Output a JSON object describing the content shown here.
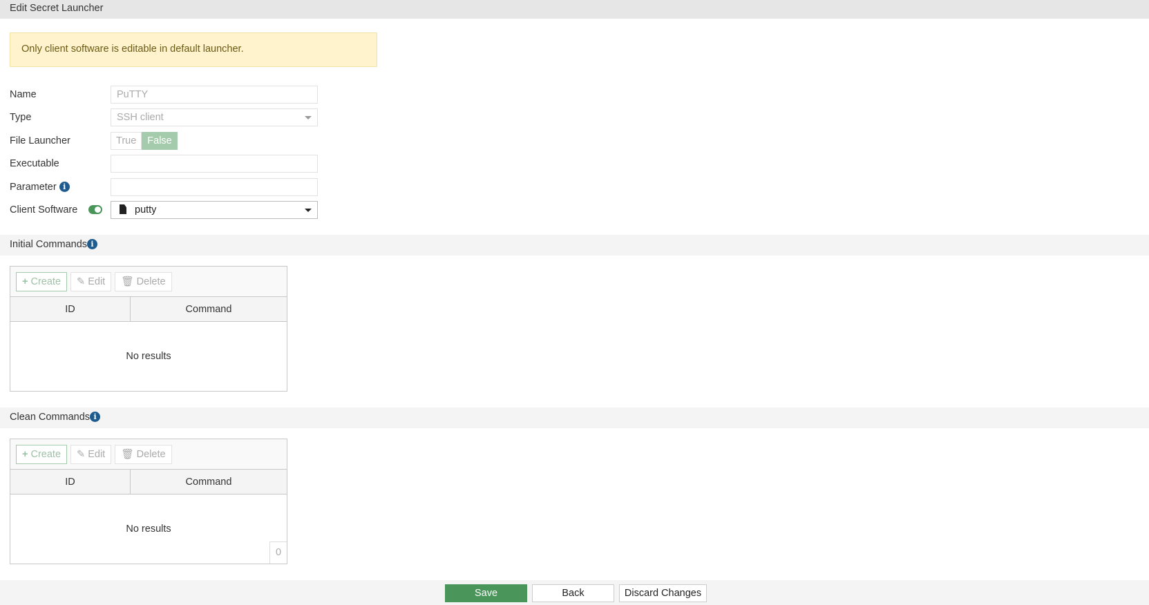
{
  "title": "Edit Secret Launcher",
  "alert": "Only client software is editable in default launcher.",
  "form": {
    "name_label": "Name",
    "name_value": "PuTTY",
    "type_label": "Type",
    "type_value": "SSH client",
    "file_launcher_label": "File Launcher",
    "true_label": "True",
    "false_label": "False",
    "executable_label": "Executable",
    "executable_value": "",
    "parameter_label": "Parameter",
    "parameter_value": "",
    "client_software_label": "Client Software",
    "client_software_value": "putty",
    "client_software_enabled": true
  },
  "initial": {
    "title": "Initial Commands",
    "create": "Create",
    "edit": "Edit",
    "delete": "Delete",
    "col_id": "ID",
    "col_command": "Command",
    "empty": "No results"
  },
  "clean": {
    "title": "Clean Commands",
    "create": "Create",
    "edit": "Edit",
    "delete": "Delete",
    "col_id": "ID",
    "col_command": "Command",
    "empty": "No results",
    "count": "0"
  },
  "footer": {
    "save": "Save",
    "back": "Back",
    "discard": "Discard Changes"
  },
  "colors": {
    "accent": "#4a955a",
    "info": "#1e5b8e"
  }
}
